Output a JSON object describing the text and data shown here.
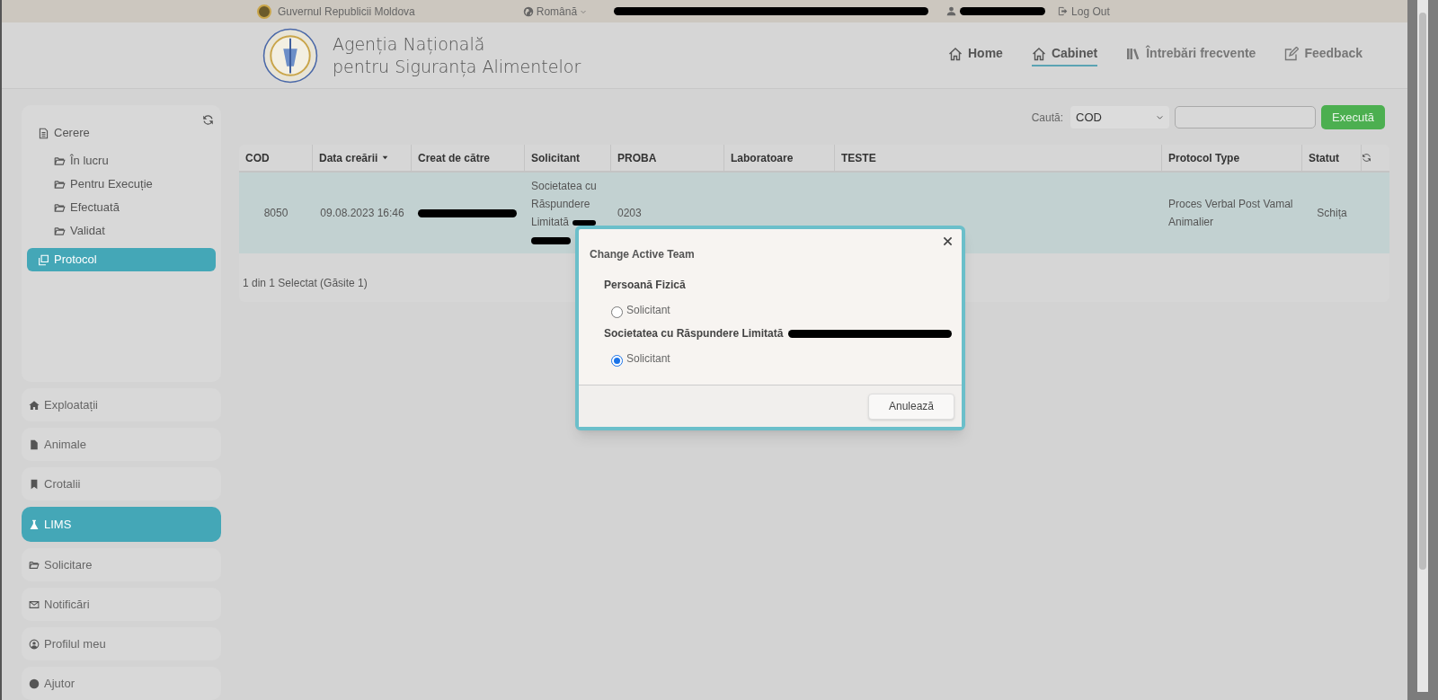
{
  "top_bar": {
    "government": "Guvernul Republicii Moldova",
    "language": "Română",
    "account_redacted": true,
    "user_redacted": true,
    "logout": "Log Out"
  },
  "header": {
    "agency_line_1": "Agenția Națională",
    "agency_line_2": "pentru Siguranța Alimentelor",
    "nav": [
      {
        "label": "Home",
        "selected": false
      },
      {
        "label": "Cabinet",
        "selected": true
      },
      {
        "label": "Întrebări frecvente",
        "selected": false
      },
      {
        "label": "Feedback",
        "selected": false
      }
    ]
  },
  "sidebar": {
    "tree": [
      {
        "label": "Cerere",
        "selected": false,
        "children": [
          {
            "label": "În lucru",
            "selected": false
          },
          {
            "label": "Pentru Execuție",
            "selected": false
          },
          {
            "label": "Efectuată",
            "selected": false
          },
          {
            "label": "Validat",
            "selected": false
          }
        ]
      },
      {
        "label": "Protocol",
        "selected": true
      }
    ],
    "menu": [
      {
        "label": "Exploatații",
        "selected": false
      },
      {
        "label": "Animale",
        "selected": false
      },
      {
        "label": "Crotalii",
        "selected": false
      },
      {
        "label": "LIMS",
        "selected": true
      },
      {
        "label": "Solicitare",
        "selected": false
      },
      {
        "label": "Notificări",
        "selected": false
      },
      {
        "label": "Profilul meu",
        "selected": false
      },
      {
        "label": "Ajutor",
        "selected": false
      }
    ]
  },
  "search": {
    "label": "Caută:",
    "field_value": "COD",
    "button": "Execută"
  },
  "table": {
    "columns": [
      {
        "label": "COD",
        "sorted": false
      },
      {
        "label": "Data creării",
        "sorted": true
      },
      {
        "label": "Creat de către",
        "sorted": false
      },
      {
        "label": "Solicitant",
        "sorted": false
      },
      {
        "label": "PROBA",
        "sorted": false
      },
      {
        "label": "Laboratoare",
        "sorted": false
      },
      {
        "label": "TESTE",
        "sorted": false
      },
      {
        "label": "Protocol Type",
        "sorted": false
      },
      {
        "label": "Statut",
        "sorted": false
      }
    ],
    "rows": [
      {
        "selected": true,
        "cells": [
          {
            "text": "8050"
          },
          {
            "text": "09.08.2023 16:46"
          },
          {
            "redacted": true
          },
          {
            "text": "Societatea cu Răspundere Limitată",
            "redacted": true
          },
          {
            "text": "0203"
          },
          {},
          {},
          {
            "text": "Proces Verbal Post Vamal Animalier"
          },
          {
            "text": "Schița"
          }
        ]
      }
    ],
    "footer": "1 din 1 Selectat (Găsite 1)"
  },
  "dialog": {
    "title": "Change Active Team",
    "groups": [
      {
        "heading": "Persoană Fizică",
        "options": [
          {
            "label": "Solicitant",
            "selected": false
          }
        ]
      },
      {
        "heading": "Societatea cu Răspundere Limitată",
        "redacted": true,
        "options": [
          {
            "label": "Solicitant",
            "selected": true
          }
        ]
      }
    ],
    "cancel": "Anulează"
  }
}
